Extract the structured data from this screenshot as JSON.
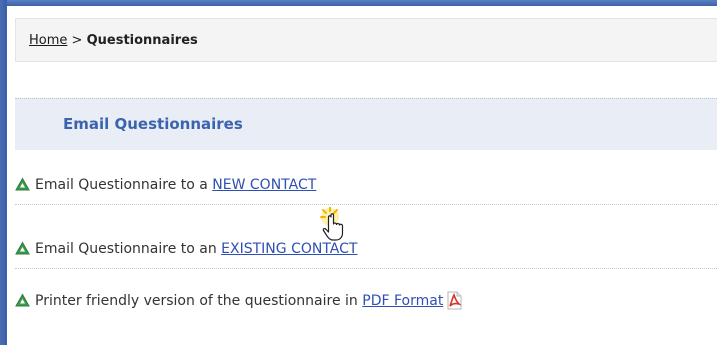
{
  "breadcrumb": {
    "home": "Home",
    "separator": ">",
    "current": "Questionnaires"
  },
  "section": {
    "title": "Email Questionnaires"
  },
  "rows": [
    {
      "text": "Email Questionnaire to a ",
      "link": "NEW CONTACT"
    },
    {
      "text": "Email Questionnaire to an ",
      "link": "EXISTING CONTACT"
    },
    {
      "text": "Printer friendly version of the questionnaire in ",
      "link": "PDF Format"
    }
  ],
  "icons": {
    "row_bullet": "green-triangle-icon",
    "pdf": "pdf-icon",
    "cursor": "hand-cursor-icon"
  },
  "colors": {
    "accent_blue": "#3c63ad",
    "link_blue": "#2f4fb5",
    "bullet_green": "#3a9a4a",
    "pdf_red": "#d9302c"
  }
}
